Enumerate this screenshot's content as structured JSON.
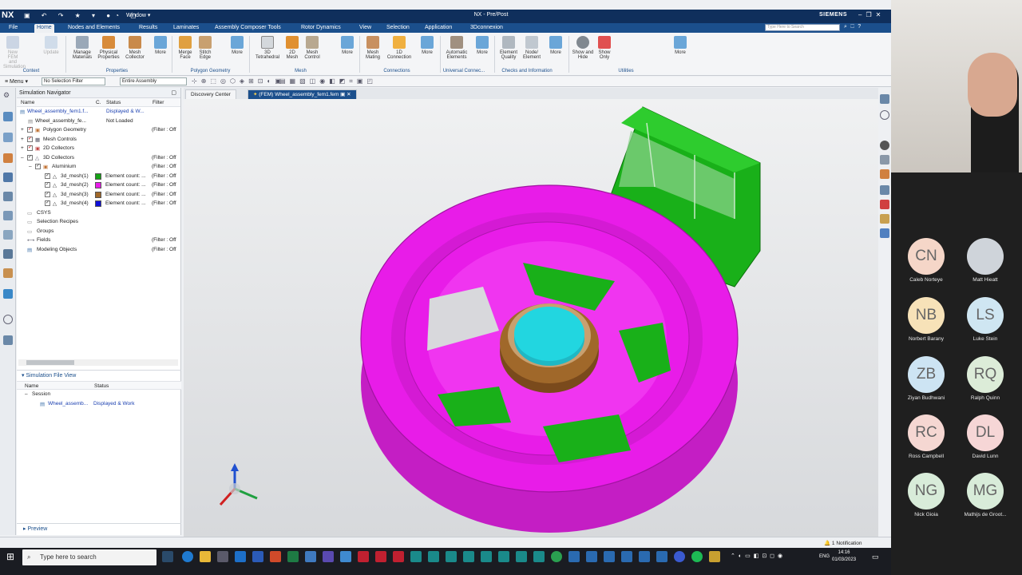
{
  "titlebar": {
    "logo": "NX",
    "window_menu": "Window",
    "title": "NX - Pre/Post",
    "brand": "SIEMENS"
  },
  "menubar": {
    "tabs": [
      "File",
      "Home",
      "Nodes and Elements",
      "Results",
      "Laminates",
      "Assembly Composer Tools",
      "Rotor Dynamics",
      "View",
      "Selection",
      "Application",
      "3Dconnexion"
    ],
    "active": "Home",
    "search_placeholder": "Type Here to Search"
  },
  "ribbon": {
    "buttons": [
      {
        "label": "New FEM and Simulation",
        "enabled": false
      },
      {
        "label": "Update",
        "enabled": false
      },
      {
        "label": "Manage Materials",
        "enabled": true
      },
      {
        "label": "Physical Properties",
        "enabled": true
      },
      {
        "label": "Mesh Collector",
        "enabled": true
      },
      {
        "label": "More",
        "enabled": true
      },
      {
        "label": "Merge Face",
        "enabled": true
      },
      {
        "label": "Stitch Edge",
        "enabled": true
      },
      {
        "label": "More",
        "enabled": true
      },
      {
        "label": "3D Tetrahedral",
        "enabled": true
      },
      {
        "label": "2D Mesh",
        "enabled": true
      },
      {
        "label": "Mesh Control",
        "enabled": true
      },
      {
        "label": "More",
        "enabled": true
      },
      {
        "label": "Mesh Mating",
        "enabled": true
      },
      {
        "label": "1D Connection",
        "enabled": true
      },
      {
        "label": "More",
        "enabled": true
      },
      {
        "label": "Automatic Elements",
        "enabled": true
      },
      {
        "label": "More",
        "enabled": true
      },
      {
        "label": "Element Quality",
        "enabled": true
      },
      {
        "label": "Node/ Element",
        "enabled": true
      },
      {
        "label": "More",
        "enabled": true
      },
      {
        "label": "Show and Hide",
        "enabled": true
      },
      {
        "label": "Show Only",
        "enabled": true
      },
      {
        "label": "More",
        "enabled": true
      }
    ],
    "groups": [
      "Context",
      "Properties",
      "Polygon Geometry",
      "Mesh",
      "Connections",
      "Universal Connec...",
      "Checks and Information",
      "Utilities"
    ]
  },
  "toolbar2": {
    "menu": "Menu",
    "selection_filter": "No Selection Filter",
    "scope": "Entire Assembly"
  },
  "navigator": {
    "title": "Simulation Navigator",
    "columns": [
      "Name",
      "C.",
      "Status",
      "Filter"
    ],
    "rows": [
      {
        "name": "Wheel_assembly_fem1.f...",
        "status": "Displayed & W...",
        "filter": "",
        "link": true
      },
      {
        "name": "Wheel_assembly_fe...",
        "status": "Not Loaded",
        "filter": "",
        "link": false
      },
      {
        "name": "Polygon Geometry",
        "status": "",
        "filter": "(Filter : Off"
      },
      {
        "name": "Mesh Controls",
        "status": "",
        "filter": ""
      },
      {
        "name": "2D Collectors",
        "status": "",
        "filter": ""
      },
      {
        "name": "3D Collectors",
        "status": "",
        "filter": "(Filter : Off"
      },
      {
        "name": "Aluminium",
        "status": "",
        "filter": "(Filter : Off"
      },
      {
        "name": "3d_mesh(1)",
        "status": "Element count: ...",
        "filter": "(Filter : Off",
        "color": "#15a315"
      },
      {
        "name": "3d_mesh(2)",
        "status": "Element count: ...",
        "filter": "(Filter : Off",
        "color": "#e81ce8"
      },
      {
        "name": "3d_mesh(3)",
        "status": "Element count: ...",
        "filter": "(Filter : Off",
        "color": "#a0682a"
      },
      {
        "name": "3d_mesh(4)",
        "status": "Element count: ...",
        "filter": "(Filter : Off",
        "color": "#1010d8"
      },
      {
        "name": "CSYS",
        "status": "",
        "filter": ""
      },
      {
        "name": "Selection Recipes",
        "status": "",
        "filter": ""
      },
      {
        "name": "Groups",
        "status": "",
        "filter": ""
      },
      {
        "name": "Fields",
        "status": "",
        "filter": "(Filter : Off"
      },
      {
        "name": "Modeling Objects",
        "status": "",
        "filter": "(Filter : Off"
      }
    ]
  },
  "file_view": {
    "title": "Simulation File View",
    "columns": [
      "Name",
      "Status"
    ],
    "session": "Session",
    "item_name": "Wheel_assemb...",
    "item_status": "Displayed & Work"
  },
  "preview": "Preview",
  "doc_tabs": [
    {
      "label": "Discovery Center",
      "active": false
    },
    {
      "label": "(FEM) Wheel_assembly_fem1.fem",
      "active": true
    }
  ],
  "status": {
    "notification": "1 Notification"
  },
  "taskbar": {
    "search_placeholder": "Type here to search",
    "language": "ENG",
    "time": "14:16",
    "date": "01/03/2023"
  },
  "participants": [
    {
      "initials": "CN",
      "name": "Caleb Norteye",
      "bg": "#f5d6c8"
    },
    {
      "initials": "",
      "name": "Matt Hieatt",
      "bg": "#cfd4da"
    },
    {
      "initials": "NB",
      "name": "Norbert Barany",
      "bg": "#f7e2b8"
    },
    {
      "initials": "LS",
      "name": "Luke Stein",
      "bg": "#cfe6f2"
    },
    {
      "initials": "ZB",
      "name": "Ziyan Budhwani",
      "bg": "#cde4f3"
    },
    {
      "initials": "RQ",
      "name": "Ralph Quinn",
      "bg": "#dcecd8"
    },
    {
      "initials": "RC",
      "name": "Ross Campbell",
      "bg": "#f5d7d2"
    },
    {
      "initials": "DL",
      "name": "David Lunn",
      "bg": "#f6d6d6"
    },
    {
      "initials": "NG",
      "name": "Nick Gioia",
      "bg": "#d8ecd9"
    },
    {
      "initials": "MG",
      "name": "Mathijs de Groot...",
      "bg": "#d8ecd9"
    }
  ],
  "colors": {
    "accent": "#1b4f8c",
    "rim": "#e81ce8",
    "bracket": "#19b019",
    "hub": "#a0682a",
    "cap": "#22d6e0"
  }
}
